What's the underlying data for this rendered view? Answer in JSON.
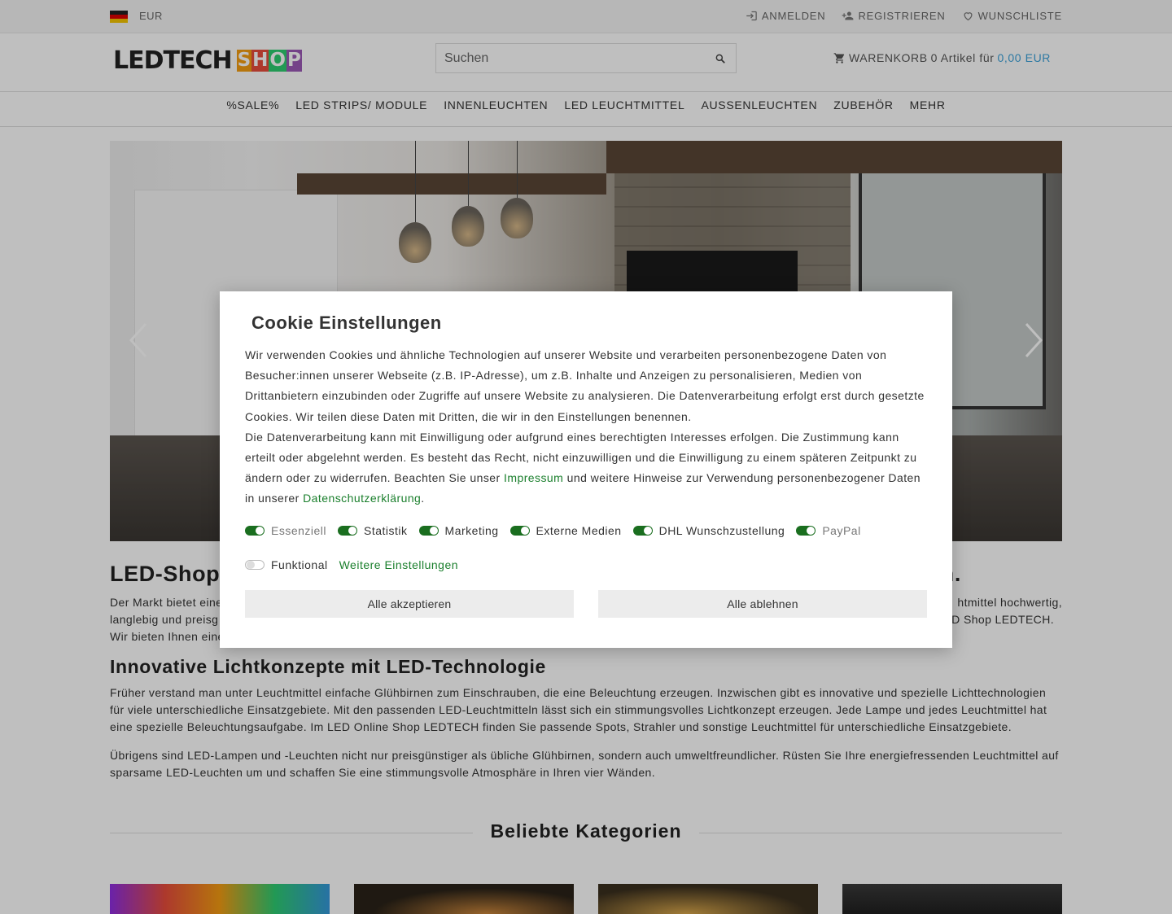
{
  "topbar": {
    "currency": "EUR",
    "links": [
      {
        "label": "ANMELDEN",
        "icon": "login-icon"
      },
      {
        "label": "REGISTRIEREN",
        "icon": "person-add-icon"
      },
      {
        "label": "WUNSCHLISTE",
        "icon": "heart-icon"
      }
    ]
  },
  "header": {
    "logo_main": "LEDTECH",
    "logo_shop": [
      "S",
      "H",
      "O",
      "P"
    ],
    "logo_shop_colors": [
      "#f39c12",
      "#e74c3c",
      "#2ecc71",
      "#9b59b6"
    ],
    "search_placeholder": "Suchen",
    "cart_label": "WARENKORB",
    "cart_count_text": "0 Artikel für",
    "cart_price": "0,00 EUR"
  },
  "nav": {
    "items": [
      "%SALE%",
      "LED STRIPS/ MODULE",
      "INNENLEUCHTEN",
      "LED LEUCHTMITTEL",
      "AUSSENLEUCHTEN",
      "ZUBEHÖR",
      "MEHR"
    ]
  },
  "content": {
    "title_left": "LED-Shop",
    "title_right": "n.",
    "intro_line1_left": "Der Markt bietet eine",
    "intro_line1_right": "htmittel hochwertig,",
    "intro_line2_left": "langlebig und preisg",
    "intro_line2_right": "ED Shop LEDTECH.",
    "intro_line3_left": "Wir bieten Ihnen eine",
    "section2_title": "Innovative Lichtkonzepte mit LED-Technologie",
    "section2_p1": "Früher verstand man unter Leuchtmittel einfache Glühbirnen zum Einschrauben, die eine Beleuchtung erzeugen. Inzwischen gibt es innovative und spezielle Lichttechnologien für viele unterschiedliche Einsatzgebiete. Mit den passenden LED-Leuchtmitteln lässt sich ein stimmungsvolles Lichtkonzept erzeugen. Jede Lampe und jedes Leuchtmittel hat eine spezielle Beleuchtungsaufgabe. Im LED Online Shop LEDTECH finden Sie passende Spots, Strahler und sonstige Leuchtmittel für unterschiedliche Einsatzgebiete.",
    "section2_p2": "Übrigens sind LED-Lampen und -Leuchten nicht nur preisgünstiger als übliche Glühbirnen, sondern auch umweltfreundlicher. Rüsten Sie Ihre energiefressenden Leuchtmittel auf sparsame LED-Leuchten um und schaffen Sie eine stimmungsvolle Atmosphäre in Ihren vier Wänden.",
    "popular_title": "Beliebte Kategorien"
  },
  "cookie": {
    "title_glyph": "",
    "title": "Cookie Einstellungen",
    "text1": "Wir verwenden Cookies und ähnliche Technologien auf unserer Website und verarbeiten personenbezogene Daten von Besucher:innen unserer Webseite (z.B. IP-Adresse), um z.B. Inhalte und Anzeigen zu personalisieren, Medien von Drittanbietern einzubinden oder Zugriffe auf unsere Website zu analysieren. Die Datenverarbeitung erfolgt erst durch gesetzte Cookies. Wir teilen diese Daten mit Dritten, die wir in den Einstellungen benennen.",
    "text2_a": "Die Datenverarbeitung kann mit Einwilligung oder aufgrund eines berechtigten Interesses erfolgen. Die Zustimmung kann erteilt oder abgelehnt werden. Es besteht das Recht, nicht einzuwilligen und die Einwilligung zu einem späteren Zeitpunkt zu ändern oder zu widerrufen. Beachten Sie unser ",
    "link_impressum": "Impressum",
    "text2_b": " und weitere Hinweise zur Verwendung personenbezogener Daten in unserer ",
    "link_privacy": "Datenschutzerklärung",
    "text2_c": ".",
    "toggles": [
      {
        "label": "Essenziell",
        "on": true,
        "muted": true
      },
      {
        "label": "Statistik",
        "on": true,
        "muted": false
      },
      {
        "label": "Marketing",
        "on": true,
        "muted": false
      },
      {
        "label": "Externe Medien",
        "on": true,
        "muted": false
      },
      {
        "label": "DHL Wunschzustellung",
        "on": true,
        "muted": false
      },
      {
        "label": "PayPal",
        "on": true,
        "muted": true
      },
      {
        "label": "Funktional",
        "on": false,
        "muted": false
      }
    ],
    "more_settings": "Weitere Einstellungen",
    "accept_all": "Alle akzeptieren",
    "reject_all": "Alle ablehnen"
  },
  "colors": {
    "accent_green": "#1a7f2c",
    "price_blue": "#3aa0d8"
  }
}
